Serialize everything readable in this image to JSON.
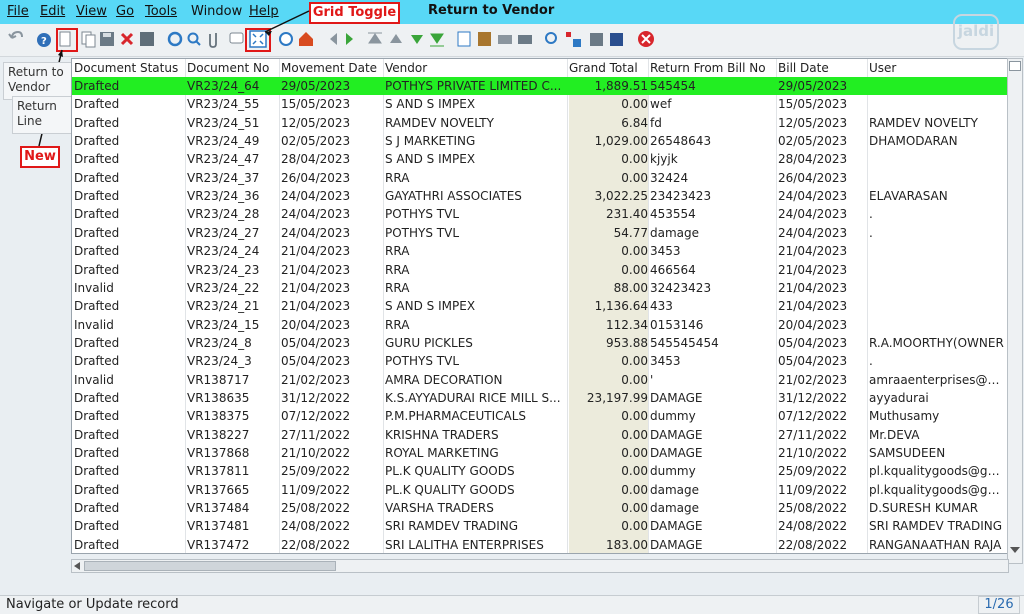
{
  "menu": [
    "File",
    "Edit",
    "View",
    "Go",
    "Tools",
    "Window",
    "Help"
  ],
  "window_title": "Return to Vendor",
  "annotations": {
    "grid_toggle": "Grid Toggle",
    "new": "New"
  },
  "watermark": "jaldi",
  "side_tabs": [
    "Return to Vendor",
    "Return Line"
  ],
  "table": {
    "columns": [
      "Document Status",
      "Document No",
      "Movement Date",
      "Vendor",
      "Grand Total",
      "Return From Bill No",
      "Bill Date",
      "User"
    ],
    "rows": [
      [
        "Drafted",
        "VR23/24_64",
        "29/05/2023",
        "POTHYS PRIVATE LIMITED C...",
        "1,889.51",
        "545454",
        "29/05/2023",
        ""
      ],
      [
        "Drafted",
        "VR23/24_55",
        "15/05/2023",
        "S AND S IMPEX",
        "0.00",
        "wef",
        "15/05/2023",
        ""
      ],
      [
        "Drafted",
        "VR23/24_51",
        "12/05/2023",
        "RAMDEV NOVELTY",
        "6.84",
        "fd",
        "12/05/2023",
        "RAMDEV NOVELTY"
      ],
      [
        "Drafted",
        "VR23/24_49",
        "02/05/2023",
        "S J MARKETING",
        "1,029.00",
        "26548643",
        "02/05/2023",
        "DHAMODARAN"
      ],
      [
        "Drafted",
        "VR23/24_47",
        "28/04/2023",
        "S AND S IMPEX",
        "0.00",
        "kjyjk",
        "28/04/2023",
        ""
      ],
      [
        "Drafted",
        "VR23/24_37",
        "26/04/2023",
        "RRA",
        "0.00",
        "32424",
        "26/04/2023",
        ""
      ],
      [
        "Drafted",
        "VR23/24_36",
        "24/04/2023",
        "GAYATHRI ASSOCIATES",
        "3,022.25",
        "23423423",
        "24/04/2023",
        "ELAVARASAN"
      ],
      [
        "Drafted",
        "VR23/24_28",
        "24/04/2023",
        "POTHYS TVL",
        "231.40",
        "453554",
        "24/04/2023",
        "."
      ],
      [
        "Drafted",
        "VR23/24_27",
        "24/04/2023",
        "POTHYS TVL",
        "54.77",
        "damage",
        "24/04/2023",
        "."
      ],
      [
        "Drafted",
        "VR23/24_24",
        "21/04/2023",
        "RRA",
        "0.00",
        "3453",
        "21/04/2023",
        ""
      ],
      [
        "Drafted",
        "VR23/24_23",
        "21/04/2023",
        "RRA",
        "0.00",
        "466564",
        "21/04/2023",
        ""
      ],
      [
        "Invalid",
        "VR23/24_22",
        "21/04/2023",
        "RRA",
        "88.00",
        "32423423",
        "21/04/2023",
        ""
      ],
      [
        "Drafted",
        "VR23/24_21",
        "21/04/2023",
        "S AND S IMPEX",
        "1,136.64",
        "433",
        "21/04/2023",
        ""
      ],
      [
        "Invalid",
        "VR23/24_15",
        "20/04/2023",
        "RRA",
        "112.34",
        "0153146",
        "20/04/2023",
        ""
      ],
      [
        "Drafted",
        "VR23/24_8",
        "05/04/2023",
        "GURU PICKLES",
        "953.88",
        "545545454",
        "05/04/2023",
        "R.A.MOORTHY(OWNER"
      ],
      [
        "Drafted",
        "VR23/24_3",
        "05/04/2023",
        "POTHYS TVL",
        "0.00",
        "3453",
        "05/04/2023",
        "."
      ],
      [
        "Invalid",
        "VR138717",
        "21/02/2023",
        "AMRA DECORATION",
        "0.00",
        "'",
        "21/02/2023",
        "amraaenterprises@gma"
      ],
      [
        "Drafted",
        "VR138635",
        "31/12/2022",
        "K.S.AYYADURAI RICE MILL S...",
        "23,197.99",
        "DAMAGE",
        "31/12/2022",
        "ayyadurai"
      ],
      [
        "Drafted",
        "VR138375",
        "07/12/2022",
        "P.M.PHARMACEUTICALS",
        "0.00",
        "dummy",
        "07/12/2022",
        "Muthusamy"
      ],
      [
        "Drafted",
        "VR138227",
        "27/11/2022",
        "KRISHNA TRADERS",
        "0.00",
        "DAMAGE",
        "27/11/2022",
        "Mr.DEVA"
      ],
      [
        "Drafted",
        "VR137868",
        "21/10/2022",
        "ROYAL MARKETING",
        "0.00",
        "DAMAGE",
        "21/10/2022",
        "SAMSUDEEN"
      ],
      [
        "Drafted",
        "VR137811",
        "25/09/2022",
        "PL.K QUALITY GOODS",
        "0.00",
        "dummy",
        "25/09/2022",
        "pl.kqualitygoods@gma"
      ],
      [
        "Drafted",
        "VR137665",
        "11/09/2022",
        "PL.K QUALITY GOODS",
        "0.00",
        "damage",
        "11/09/2022",
        "pl.kqualitygoods@gma"
      ],
      [
        "Drafted",
        "VR137484",
        "25/08/2022",
        "VARSHA TRADERS",
        "0.00",
        "damage",
        "25/08/2022",
        "D.SURESH KUMAR"
      ],
      [
        "Drafted",
        "VR137481",
        "24/08/2022",
        "SRI RAMDEV TRADING",
        "0.00",
        "DAMAGE",
        "24/08/2022",
        "SRI RAMDEV TRADING"
      ],
      [
        "Drafted",
        "VR137472",
        "22/08/2022",
        "SRI LALITHA ENTERPRISES",
        "183.00",
        "DAMAGE",
        "22/08/2022",
        "RANGANAATHAN RAJA"
      ]
    ]
  },
  "status": {
    "message": "Navigate or Update record",
    "page": "1/26"
  },
  "colors": {
    "menubar": "#58d8f6",
    "selected_row": "#22ee22",
    "callout": "#e01818",
    "status_col": "#ecebdc"
  }
}
